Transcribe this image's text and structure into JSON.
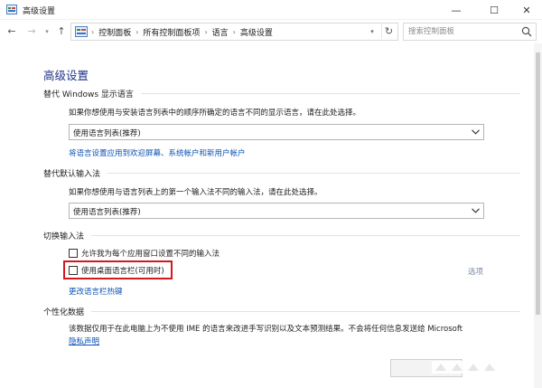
{
  "window": {
    "title": "高级设置",
    "minimize_glyph": "—",
    "maximize_glyph": "☐",
    "close_glyph": "✕"
  },
  "nav": {
    "back_glyph": "←",
    "forward_glyph": "→",
    "dropdown_glyph": "▾",
    "up_glyph": "↑",
    "refresh_glyph": "↻"
  },
  "address": {
    "breadcrumbs": [
      "控制面板",
      "所有控制面板项",
      "语言",
      "高级设置"
    ],
    "separator": "›",
    "dropdown_glyph": "▾"
  },
  "search": {
    "placeholder": "搜索控制面板"
  },
  "page": {
    "title": "高级设置"
  },
  "sections": {
    "display_language": {
      "heading": "替代 Windows 显示语言",
      "description": "如果你想使用与安装语言列表中的顺序所确定的语言不同的显示语言，请在此处选择。",
      "selected": "使用语言列表(推荐)",
      "link": "将语言设置应用到欢迎屏幕、系统帐户和新用户帐户"
    },
    "default_input": {
      "heading": "替代默认输入法",
      "description": "如果你想使用与语言列表上的第一个输入法不同的输入法，请在此处选择。",
      "selected": "使用语言列表(推荐)"
    },
    "switch_input": {
      "heading": "切换输入法",
      "checkbox1": "允许我为每个应用窗口设置不同的输入法",
      "checkbox2": "使用桌面语言栏(可用时)",
      "options_link": "选项",
      "hotkey_link": "更改语言栏热键"
    },
    "personalization": {
      "heading": "个性化数据",
      "description": "该数据仅用于在此电脑上为不使用 IME 的语言来改进手写识别以及文本预测结果。不会将任何信息发送给 Microsoft",
      "privacy_link": "隐私声明"
    }
  },
  "colors": {
    "title_blue": "#1e3287",
    "link_blue": "#0a50b4",
    "highlight_red": "#d2191e"
  },
  "icons": {
    "app": "control-panel-icon",
    "search": "magnifier-icon"
  }
}
